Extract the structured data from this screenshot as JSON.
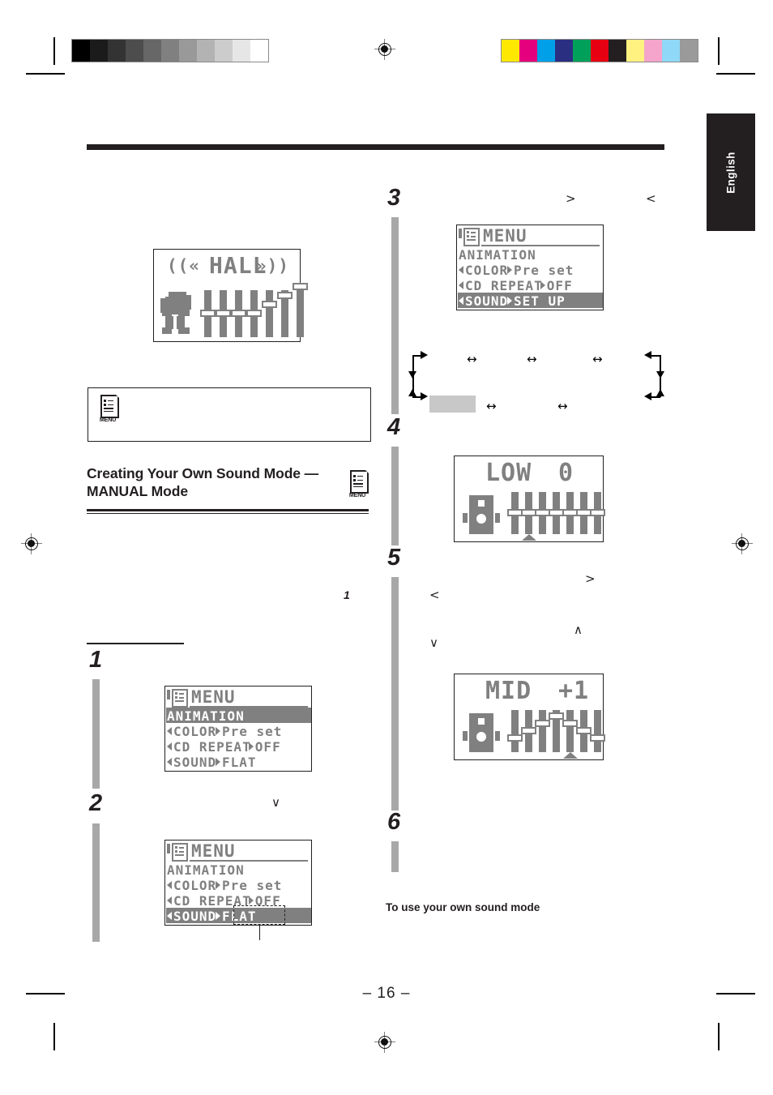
{
  "page": {
    "number_label": "– 16 –",
    "language_tab": "English",
    "accent_color": "#231f20",
    "lcd_pixel_color": "#808080",
    "step_bar_color": "#a8a8a8"
  },
  "section": {
    "heading_line1": "Creating Your Own Sound Mode —",
    "heading_line2": "MANUAL Mode",
    "heading_icon": "menu-document-icon",
    "subheading": "To use your own sound mode"
  },
  "note_box": {
    "icon": "menu-document-icon",
    "icon_label": "MENU"
  },
  "menu_icon_label": "MENU",
  "steps": [
    {
      "number": "1"
    },
    {
      "number": "2"
    },
    {
      "number": "3"
    },
    {
      "number": "4"
    },
    {
      "number": "5"
    },
    {
      "number": "6"
    }
  ],
  "displays": {
    "hall": {
      "name": "hall-sound-mode-display",
      "title": "HALL",
      "left_wave": "((«",
      "right_wave": "»))",
      "icon": "dancing-elephant-icon",
      "slider_count": 7,
      "slider_levels": [
        0,
        0,
        0,
        0,
        1,
        2,
        3
      ]
    },
    "menu_animation": {
      "name": "menu-screen-animation-selected",
      "title": "MENU",
      "title_icon": "menu-document-icon",
      "rows": [
        {
          "label": "ANIMATION",
          "value": "",
          "highlighted": true,
          "arrows": false
        },
        {
          "label": "COLOR",
          "value": "Pre set",
          "highlighted": false,
          "arrows": true
        },
        {
          "label": "CD REPEAT",
          "value": "OFF",
          "highlighted": false,
          "arrows": true
        },
        {
          "label": "SOUND",
          "value": "FLAT",
          "highlighted": false,
          "arrows": true
        }
      ]
    },
    "menu_sound_flat": {
      "name": "menu-screen-sound-flat-selected",
      "title": "MENU",
      "title_icon": "menu-document-icon",
      "rows": [
        {
          "label": "ANIMATION",
          "value": "",
          "highlighted": false,
          "arrows": false
        },
        {
          "label": "COLOR",
          "value": "Pre set",
          "highlighted": false,
          "arrows": true
        },
        {
          "label": "CD REPEAT",
          "value": "OFF",
          "highlighted": false,
          "arrows": true
        },
        {
          "label": "SOUND",
          "value": "FLAT",
          "highlighted": true,
          "arrows": true
        }
      ],
      "callout_target": "FLAT"
    },
    "menu_sound_setup": {
      "name": "menu-screen-sound-set-up-selected",
      "title": "MENU",
      "title_icon": "menu-document-icon",
      "rows": [
        {
          "label": "ANIMATION",
          "value": "",
          "highlighted": false,
          "arrows": false
        },
        {
          "label": "COLOR",
          "value": "Pre set",
          "highlighted": false,
          "arrows": true
        },
        {
          "label": "CD REPEAT",
          "value": "OFF",
          "highlighted": false,
          "arrows": true
        },
        {
          "label": "SOUND",
          "value": "SET UP",
          "highlighted": true,
          "arrows": true
        }
      ]
    },
    "eq_low": {
      "name": "equalizer-low-band-display",
      "band": "LOW",
      "level": "0",
      "icon": "speaker-cabinet-icon",
      "slider_count": 7,
      "slider_levels": [
        0,
        0,
        0,
        0,
        0,
        0,
        0
      ],
      "marker_index": 1
    },
    "eq_mid": {
      "name": "equalizer-mid-band-display",
      "band": "MID",
      "level": "+1",
      "icon": "speaker-cabinet-icon",
      "slider_count": 7,
      "slider_levels": [
        -1,
        0,
        1,
        2,
        1,
        0,
        -1
      ],
      "marker_index": 4
    }
  },
  "cycle_diagram": {
    "name": "sound-mode-cycle-diagram",
    "highlight_chip": "#c8c8c8",
    "top_arrows": 3,
    "bottom_arrows": 2,
    "arrow_glyph": "↔"
  },
  "stray_glyphs": {
    "gt": ">",
    "lt": "<",
    "up": "∧",
    "down": "∨",
    "one": "1"
  },
  "calibration": {
    "grayscale_steps": [
      "#000000",
      "#1b1b1b",
      "#333333",
      "#4d4d4d",
      "#676767",
      "#808080",
      "#999999",
      "#b3b3b3",
      "#cccccc",
      "#e6e6e6",
      "#ffffff"
    ],
    "color_steps": [
      "#ffe800",
      "#e5007d",
      "#00a0e9",
      "#2b2f82",
      "#00a05a",
      "#e60012",
      "#231f20",
      "#fff280",
      "#f5a4cb",
      "#8fd8f7",
      "#9a9a9a"
    ]
  }
}
